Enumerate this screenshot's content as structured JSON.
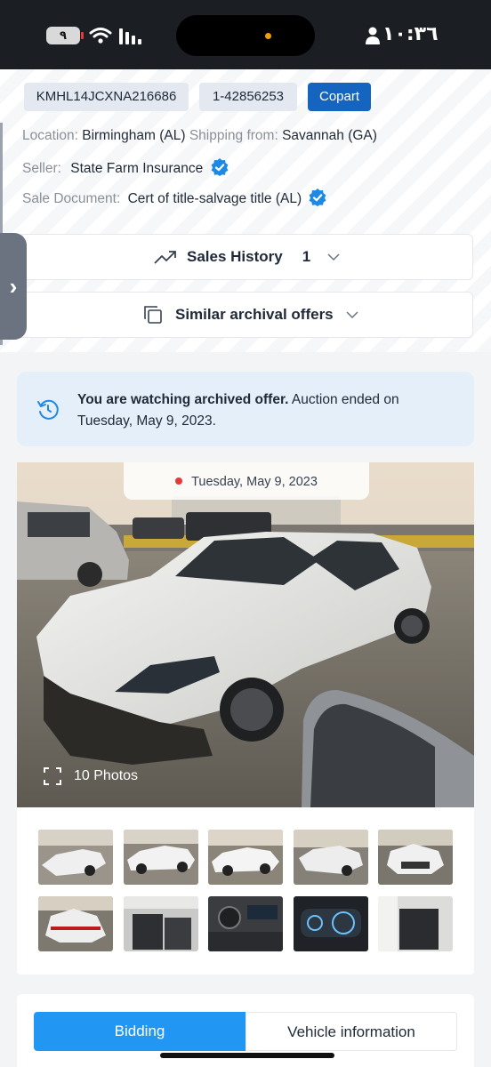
{
  "status_bar": {
    "battery": "٩",
    "time": "١٠:٣٦",
    "icons": [
      "battery-icon",
      "wifi-icon",
      "cellular-signal-icon",
      "person-icon"
    ]
  },
  "lot": {
    "vin": "KMHL14JCXNA216686",
    "lot_number": "1-42856253",
    "auction": "Copart",
    "location_label": "Location:",
    "location_value": "Birmingham (AL)",
    "shipping_label": "Shipping from:",
    "shipping_value": "Savannah (GA)",
    "seller_label": "Seller:",
    "seller_value": "State Farm Insurance",
    "sale_doc_label": "Sale Document:",
    "sale_doc_value": "Cert of title-salvage title (AL)"
  },
  "sales_history": {
    "label": "Sales History",
    "count": "1"
  },
  "similar": {
    "label": "Similar archival offers"
  },
  "side_tab": {
    "glyph": "›"
  },
  "notice": {
    "bold": "You are watching archived offer.",
    "rest": " Auction ended on Tuesday, May 9, 2023."
  },
  "gallery": {
    "date": "Tuesday, May 9, 2023",
    "photos_label": "10 Photos",
    "thumbnail_count": 10
  },
  "tabs": {
    "bidding": "Bidding",
    "vehicle_info": "Vehicle information"
  },
  "colors": {
    "accent_blue": "#2196f3",
    "copart_blue": "#1565c0",
    "verified_blue": "#1e88e5",
    "notice_bg": "#e4eff9"
  }
}
